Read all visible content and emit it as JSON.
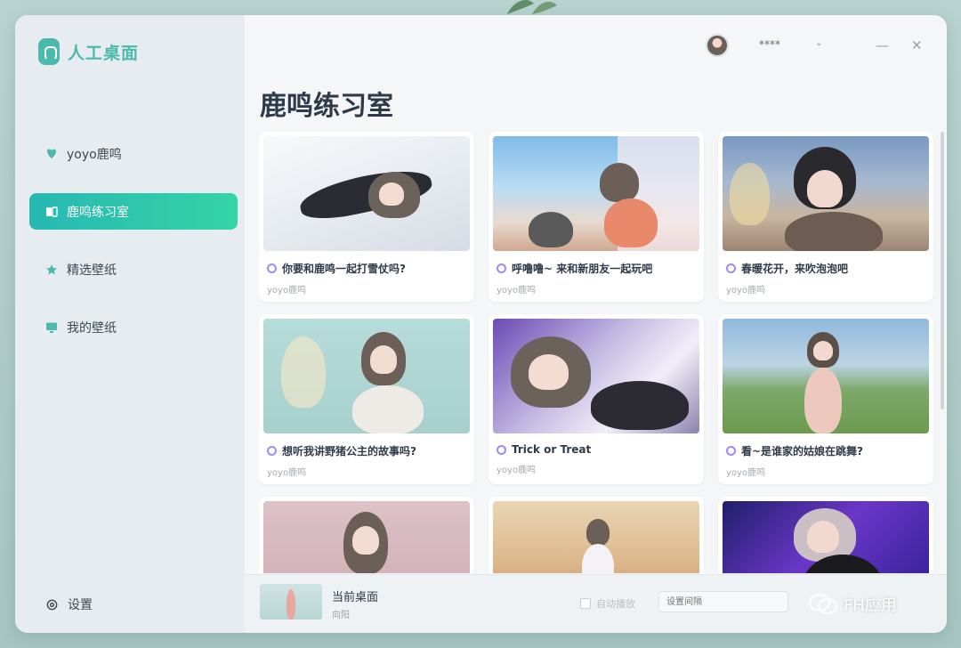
{
  "app": {
    "name": "人工桌面"
  },
  "sidebar": {
    "items": [
      {
        "label": "yoyo鹿鸣",
        "icon": "heart-leaf-icon",
        "active": false
      },
      {
        "label": "鹿鸣练习室",
        "icon": "practice-room-icon",
        "active": true
      },
      {
        "label": "精选壁纸",
        "icon": "star-icon",
        "active": false
      },
      {
        "label": "我的壁纸",
        "icon": "monitor-icon",
        "active": false
      }
    ],
    "settings_label": "设置"
  },
  "header": {
    "username": "****",
    "minimize": "—",
    "close": "✕"
  },
  "main": {
    "title": "鹿鸣练习室",
    "cards": [
      {
        "title": "你要和鹿鸣一起打雪仗吗?",
        "author": "yoyo鹿鸣"
      },
      {
        "title": "呼噜噜~ 来和新朋友一起玩吧",
        "author": "yoyo鹿鸣"
      },
      {
        "title": "春暖花开，来吹泡泡吧",
        "author": "yoyo鹿鸣"
      },
      {
        "title": "想听我讲野猪公主的故事吗?",
        "author": "yoyo鹿鸣"
      },
      {
        "title": "Trick or Treat",
        "author": "yoyo鹿鸣"
      },
      {
        "title": "看~是谁家的姑娘在跳舞?",
        "author": "yoyo鹿鸣"
      },
      {
        "title": "",
        "author": ""
      },
      {
        "title": "",
        "author": ""
      },
      {
        "title": "",
        "author": ""
      }
    ]
  },
  "bottombar": {
    "now_title": "当前桌面",
    "now_subtitle": "向阳",
    "autoplay_label": "自动播放",
    "input_placeholder": "设置间隔"
  },
  "watermark": {
    "text": "FH应用"
  },
  "colors": {
    "accent": "#2fc6ad",
    "title": "#2f3a48",
    "sidebar_bg": "#e6ecef"
  }
}
